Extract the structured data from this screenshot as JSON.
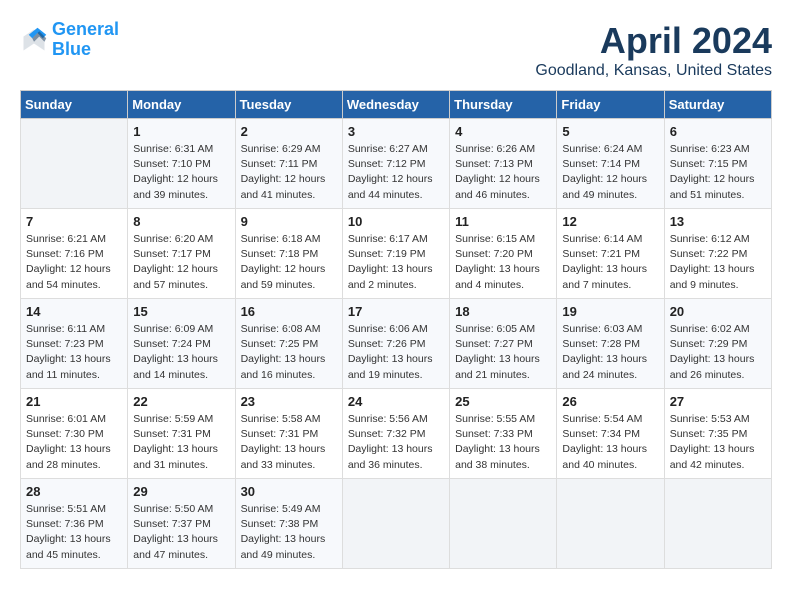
{
  "header": {
    "logo_line1": "General",
    "logo_line2": "Blue",
    "month": "April 2024",
    "location": "Goodland, Kansas, United States"
  },
  "weekdays": [
    "Sunday",
    "Monday",
    "Tuesday",
    "Wednesday",
    "Thursday",
    "Friday",
    "Saturday"
  ],
  "weeks": [
    [
      {
        "day": "",
        "info": ""
      },
      {
        "day": "1",
        "info": "Sunrise: 6:31 AM\nSunset: 7:10 PM\nDaylight: 12 hours\nand 39 minutes."
      },
      {
        "day": "2",
        "info": "Sunrise: 6:29 AM\nSunset: 7:11 PM\nDaylight: 12 hours\nand 41 minutes."
      },
      {
        "day": "3",
        "info": "Sunrise: 6:27 AM\nSunset: 7:12 PM\nDaylight: 12 hours\nand 44 minutes."
      },
      {
        "day": "4",
        "info": "Sunrise: 6:26 AM\nSunset: 7:13 PM\nDaylight: 12 hours\nand 46 minutes."
      },
      {
        "day": "5",
        "info": "Sunrise: 6:24 AM\nSunset: 7:14 PM\nDaylight: 12 hours\nand 49 minutes."
      },
      {
        "day": "6",
        "info": "Sunrise: 6:23 AM\nSunset: 7:15 PM\nDaylight: 12 hours\nand 51 minutes."
      }
    ],
    [
      {
        "day": "7",
        "info": "Sunrise: 6:21 AM\nSunset: 7:16 PM\nDaylight: 12 hours\nand 54 minutes."
      },
      {
        "day": "8",
        "info": "Sunrise: 6:20 AM\nSunset: 7:17 PM\nDaylight: 12 hours\nand 57 minutes."
      },
      {
        "day": "9",
        "info": "Sunrise: 6:18 AM\nSunset: 7:18 PM\nDaylight: 12 hours\nand 59 minutes."
      },
      {
        "day": "10",
        "info": "Sunrise: 6:17 AM\nSunset: 7:19 PM\nDaylight: 13 hours\nand 2 minutes."
      },
      {
        "day": "11",
        "info": "Sunrise: 6:15 AM\nSunset: 7:20 PM\nDaylight: 13 hours\nand 4 minutes."
      },
      {
        "day": "12",
        "info": "Sunrise: 6:14 AM\nSunset: 7:21 PM\nDaylight: 13 hours\nand 7 minutes."
      },
      {
        "day": "13",
        "info": "Sunrise: 6:12 AM\nSunset: 7:22 PM\nDaylight: 13 hours\nand 9 minutes."
      }
    ],
    [
      {
        "day": "14",
        "info": "Sunrise: 6:11 AM\nSunset: 7:23 PM\nDaylight: 13 hours\nand 11 minutes."
      },
      {
        "day": "15",
        "info": "Sunrise: 6:09 AM\nSunset: 7:24 PM\nDaylight: 13 hours\nand 14 minutes."
      },
      {
        "day": "16",
        "info": "Sunrise: 6:08 AM\nSunset: 7:25 PM\nDaylight: 13 hours\nand 16 minutes."
      },
      {
        "day": "17",
        "info": "Sunrise: 6:06 AM\nSunset: 7:26 PM\nDaylight: 13 hours\nand 19 minutes."
      },
      {
        "day": "18",
        "info": "Sunrise: 6:05 AM\nSunset: 7:27 PM\nDaylight: 13 hours\nand 21 minutes."
      },
      {
        "day": "19",
        "info": "Sunrise: 6:03 AM\nSunset: 7:28 PM\nDaylight: 13 hours\nand 24 minutes."
      },
      {
        "day": "20",
        "info": "Sunrise: 6:02 AM\nSunset: 7:29 PM\nDaylight: 13 hours\nand 26 minutes."
      }
    ],
    [
      {
        "day": "21",
        "info": "Sunrise: 6:01 AM\nSunset: 7:30 PM\nDaylight: 13 hours\nand 28 minutes."
      },
      {
        "day": "22",
        "info": "Sunrise: 5:59 AM\nSunset: 7:31 PM\nDaylight: 13 hours\nand 31 minutes."
      },
      {
        "day": "23",
        "info": "Sunrise: 5:58 AM\nSunset: 7:31 PM\nDaylight: 13 hours\nand 33 minutes."
      },
      {
        "day": "24",
        "info": "Sunrise: 5:56 AM\nSunset: 7:32 PM\nDaylight: 13 hours\nand 36 minutes."
      },
      {
        "day": "25",
        "info": "Sunrise: 5:55 AM\nSunset: 7:33 PM\nDaylight: 13 hours\nand 38 minutes."
      },
      {
        "day": "26",
        "info": "Sunrise: 5:54 AM\nSunset: 7:34 PM\nDaylight: 13 hours\nand 40 minutes."
      },
      {
        "day": "27",
        "info": "Sunrise: 5:53 AM\nSunset: 7:35 PM\nDaylight: 13 hours\nand 42 minutes."
      }
    ],
    [
      {
        "day": "28",
        "info": "Sunrise: 5:51 AM\nSunset: 7:36 PM\nDaylight: 13 hours\nand 45 minutes."
      },
      {
        "day": "29",
        "info": "Sunrise: 5:50 AM\nSunset: 7:37 PM\nDaylight: 13 hours\nand 47 minutes."
      },
      {
        "day": "30",
        "info": "Sunrise: 5:49 AM\nSunset: 7:38 PM\nDaylight: 13 hours\nand 49 minutes."
      },
      {
        "day": "",
        "info": ""
      },
      {
        "day": "",
        "info": ""
      },
      {
        "day": "",
        "info": ""
      },
      {
        "day": "",
        "info": ""
      }
    ]
  ]
}
